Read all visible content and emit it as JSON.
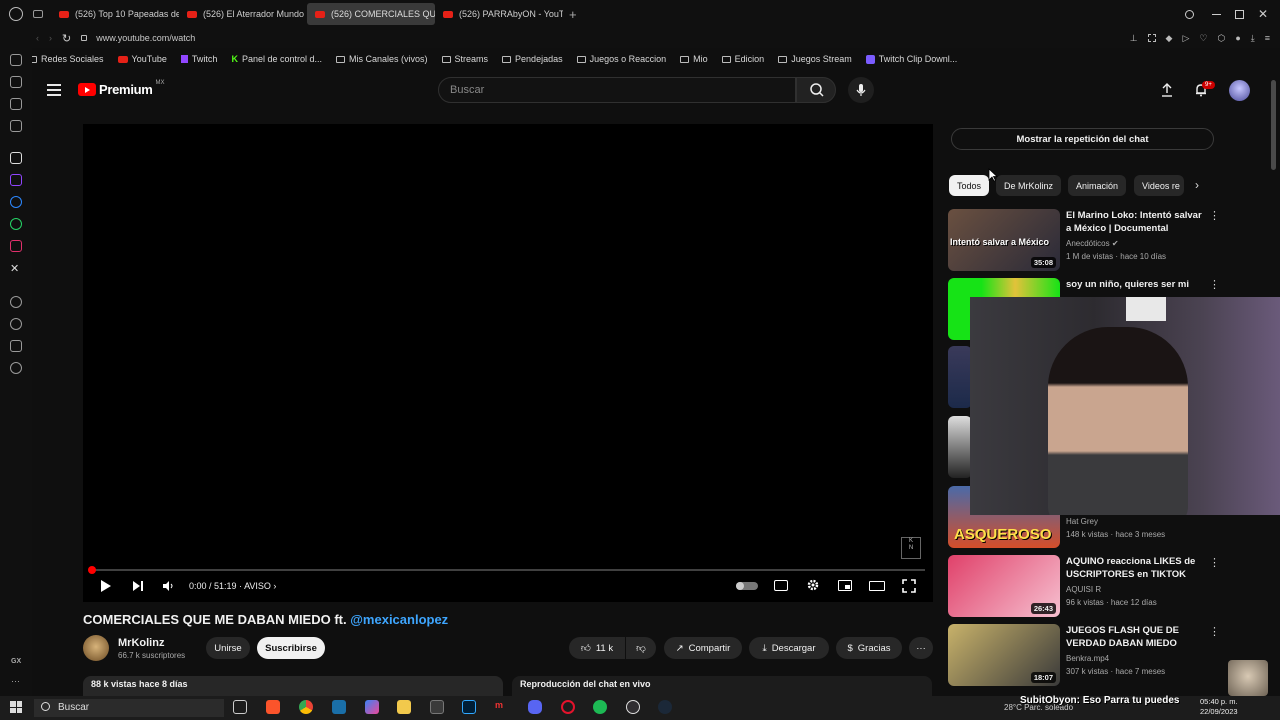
{
  "browser": {
    "tabs": [
      {
        "label": "(526) Top 10 Papeadas de"
      },
      {
        "label": "(526) El Aterrador Mundo"
      },
      {
        "label": "(526) COMERCIALES QU",
        "active": true
      },
      {
        "label": "(526) PARRAbyON - YouT"
      }
    ],
    "url": "www.youtube.com/watch",
    "bookmarks": [
      "Redes Sociales",
      "YouTube",
      "Twitch",
      "Panel de control d...",
      "Mis Canales (vivos)",
      "Streams",
      "Pendejadas",
      "Juegos o Reaccion",
      "Mio",
      "Edicion",
      "Juegos Stream",
      "Twitch Clip Downl..."
    ],
    "rail_label": "GX"
  },
  "header": {
    "logo_text": "Premium",
    "logo_region": "MX",
    "search_placeholder": "Buscar",
    "notifications_badge": "9+"
  },
  "player": {
    "timecode": "0:00 / 51:19",
    "ad_label": "AVISO",
    "progress": 0.0
  },
  "video": {
    "title": "COMERCIALES QUE ME DABAN MIEDO ft.",
    "mention": "@mexicanlopez",
    "channel_name": "MrKolinz",
    "subscribers": "66.7 k suscriptores",
    "join_label": "Unirse",
    "subscribe_label": "Suscribirse",
    "like_count": "11 k",
    "share_label": "Compartir",
    "download_label": "Descargar",
    "thanks_label": "Gracias",
    "views_date": "88 k vistas  hace 8 días",
    "chat_replay_label": "Reproducción del chat en vivo"
  },
  "sidebar": {
    "chat_replay_button": "Mostrar la repetición del chat",
    "chips": [
      "Todos",
      "De MrKolinz",
      "Animación",
      "Videos re"
    ],
    "recommendations": [
      {
        "title": "El Marino Loko: Intentó salvar a México | Documental",
        "channel": "Anecdóticos",
        "meta": "1 M de vistas · hace 10 días",
        "duration": "35:08",
        "thumb_text": "Intentó salvar a México"
      },
      {
        "title": "soy un niño, quieres ser mi amigo?",
        "channel": "",
        "meta": "",
        "duration": ""
      },
      {
        "title": "",
        "channel": "Hat Grey",
        "meta": "148 k vistas · hace 3 meses",
        "duration": "",
        "thumb_text": "ASQUEROSO"
      },
      {
        "title": "AQUINO reacciona LIKES de USCRIPTORES en TIKTOK",
        "channel": "AQUISI R",
        "meta": "96 k vistas · hace 12 días",
        "duration": "26:43"
      },
      {
        "title": "JUEGOS FLASH QUE DE VERDAD DABAN MIEDO",
        "channel": "Benkra.mp4",
        "meta": "307 k vistas · hace 7 meses",
        "duration": "18:07"
      }
    ]
  },
  "overlay": {
    "chat_line": "SubitObyon: Eso Parra tu puedes",
    "weather": "28°C  Parc. soleado"
  },
  "taskbar": {
    "search_label": "Buscar",
    "time": "05:40 p. m.",
    "date": "22/09/2023"
  }
}
